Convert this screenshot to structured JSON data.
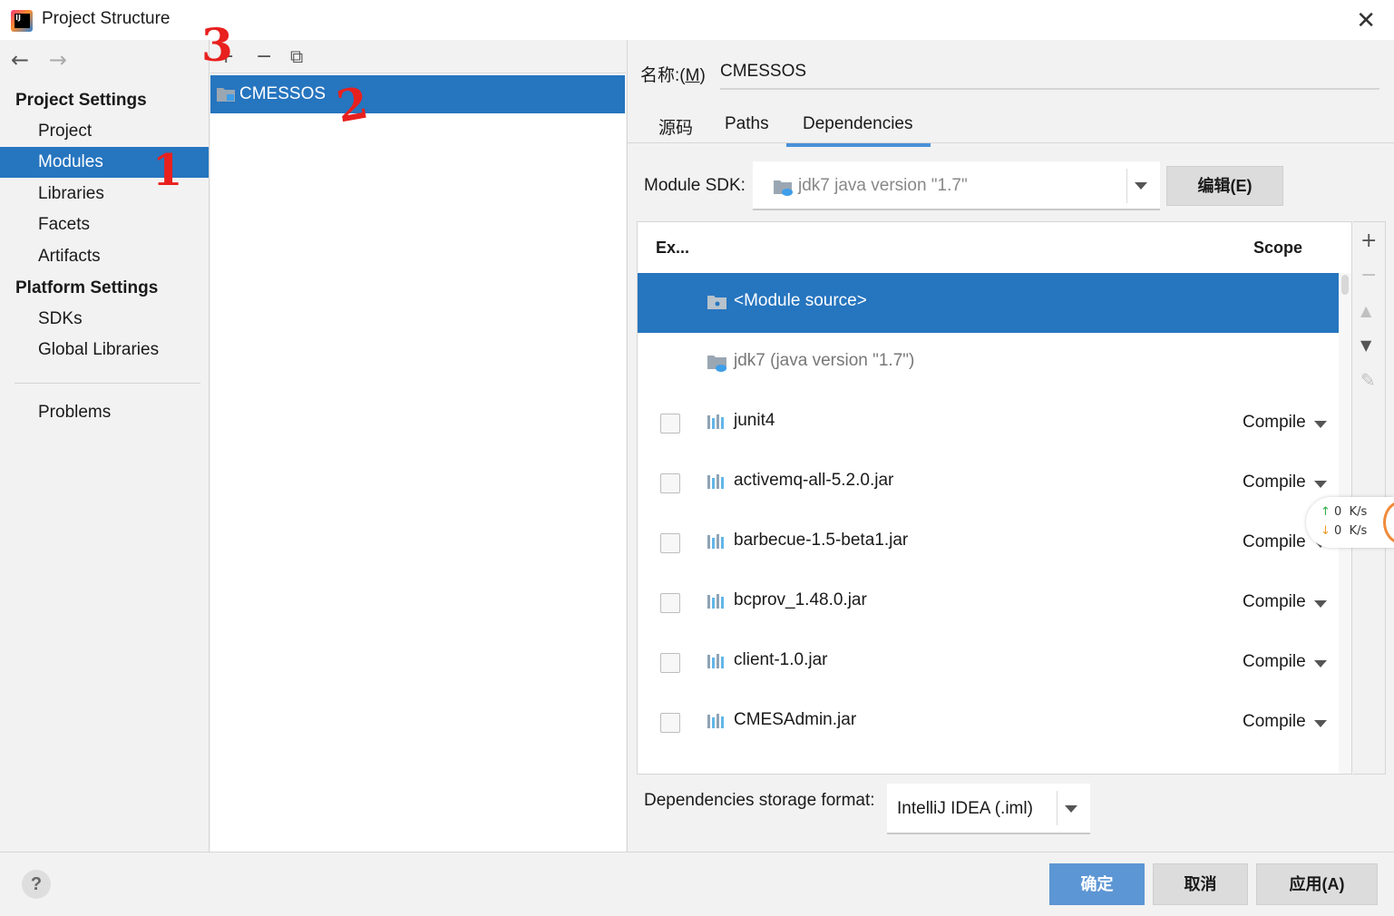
{
  "window": {
    "title": "Project Structure",
    "close": "✕"
  },
  "nav": {
    "back": "←",
    "forward": "→",
    "sections": [
      {
        "label": "Project Settings",
        "items": [
          "Project",
          "Modules",
          "Libraries",
          "Facets",
          "Artifacts"
        ]
      },
      {
        "label": "Platform Settings",
        "items": [
          "SDKs",
          "Global Libraries"
        ]
      }
    ],
    "problems": "Problems",
    "selected": "Modules"
  },
  "modules": {
    "toolbar": {
      "add": "+",
      "remove": "−",
      "copy": "⧉"
    },
    "items": [
      "CMESSOS"
    ]
  },
  "detail": {
    "name_label_prefix": "名称:(",
    "name_label_mnemonic": "M",
    "name_label_suffix": ")",
    "name_value": "CMESSOS",
    "tabs": [
      "源码",
      "Paths",
      "Dependencies"
    ],
    "active_tab": "Dependencies",
    "module_sdk_label": "Module SDK:",
    "module_sdk_value": "jdk7 java version \"1.7\"",
    "edit_button": "编辑(E)",
    "table": {
      "header_export": "Ex...",
      "header_scope": "Scope",
      "rows": [
        {
          "name": "<Module source>",
          "scope": "",
          "has_checkbox": false,
          "icon": "folder-source-icon",
          "selected": true
        },
        {
          "name": "jdk7 (java version \"1.7\")",
          "scope": "",
          "has_checkbox": false,
          "icon": "jdk-folder-icon",
          "selected": false
        },
        {
          "name": "junit4",
          "scope": "Compile",
          "has_checkbox": true,
          "icon": "library-icon",
          "selected": false
        },
        {
          "name": "activemq-all-5.2.0.jar",
          "scope": "Compile",
          "has_checkbox": true,
          "icon": "library-icon",
          "selected": false
        },
        {
          "name": "barbecue-1.5-beta1.jar",
          "scope": "Compile",
          "has_checkbox": true,
          "icon": "library-icon",
          "selected": false
        },
        {
          "name": "bcprov_1.48.0.jar",
          "scope": "Compile",
          "has_checkbox": true,
          "icon": "library-icon",
          "selected": false
        },
        {
          "name": "client-1.0.jar",
          "scope": "Compile",
          "has_checkbox": true,
          "icon": "library-icon",
          "selected": false
        },
        {
          "name": "CMESAdmin.jar",
          "scope": "Compile",
          "has_checkbox": true,
          "icon": "library-icon",
          "selected": false
        }
      ]
    },
    "side_tools": {
      "add": "+",
      "remove": "−",
      "up": "▲",
      "down": "▼",
      "edit": "✎"
    },
    "storage_label": "Dependencies storage format:",
    "storage_value": "IntelliJ IDEA (.iml)"
  },
  "netspeed": {
    "up_value": "0",
    "up_unit": "K/s",
    "down_value": "0",
    "down_unit": "K/s"
  },
  "footer": {
    "help": "?",
    "ok": "确定",
    "cancel": "取消",
    "apply": "应用(A)"
  },
  "annotations": [
    "1",
    "2",
    "3"
  ],
  "colors": {
    "selection": "#2675bf",
    "primary_button": "#5d96d4",
    "annotation": "#e8201e"
  }
}
